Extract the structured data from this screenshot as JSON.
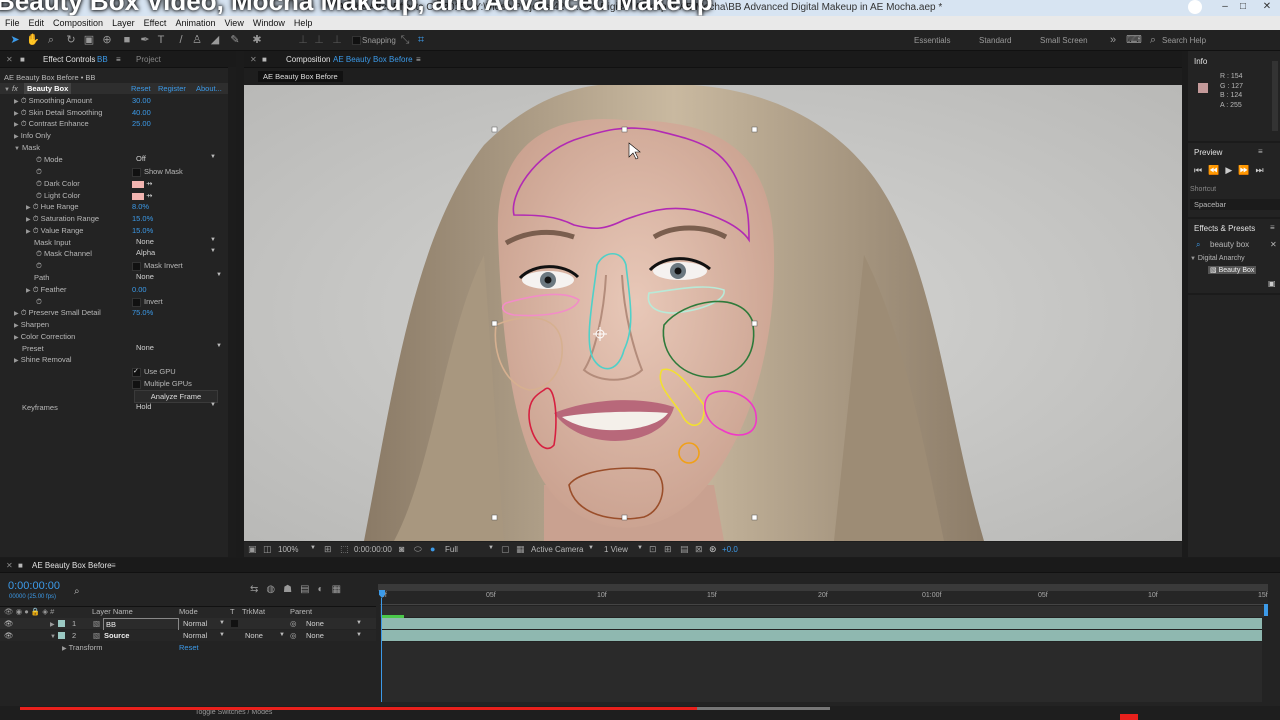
{
  "overlay_title": "Beauty Box Video, Mocha Makeup, and Advanced Makeup",
  "window": {
    "title": "Adobe After Effects CC 2015 - Y:\\Video Projects\\42 - ...ced Digital Makeup in AE Mocha\\BB Advanced Digital Makeup in AE Mocha.aep *"
  },
  "menu": [
    "File",
    "Edit",
    "Composition",
    "Layer",
    "Effect",
    "Animation",
    "View",
    "Window",
    "Help"
  ],
  "toolbar": {
    "snapping": "Snapping",
    "workspaces": [
      "Essentials",
      "Standard",
      "Small Screen"
    ],
    "search_help": "Search Help"
  },
  "effect_controls": {
    "tab": "Effect Controls",
    "tab_layer": "BB",
    "tab_project": "Project",
    "breadcrumb": "AE Beauty Box Before • BB",
    "effect_name": "Beauty Box",
    "reset": "Reset",
    "register": "Register",
    "about": "About...",
    "params": [
      {
        "label": "Smoothing Amount",
        "value": "30.00"
      },
      {
        "label": "Skin Detail Smoothing",
        "value": "40.00"
      },
      {
        "label": "Contrast Enhance",
        "value": "25.00"
      },
      {
        "label": "Info Only",
        "value": ""
      },
      {
        "label": "Mask",
        "value": ""
      },
      {
        "label": "Mode",
        "value": "Off"
      },
      {
        "label": "",
        "value": "Show Mask"
      },
      {
        "label": "Dark Color",
        "value": ""
      },
      {
        "label": "Light Color",
        "value": ""
      },
      {
        "label": "Hue Range",
        "value": "8.0%"
      },
      {
        "label": "Saturation Range",
        "value": "15.0%"
      },
      {
        "label": "Value Range",
        "value": "15.0%"
      },
      {
        "label": "Mask Input",
        "value": "None"
      },
      {
        "label": "Mask Channel",
        "value": "Alpha"
      },
      {
        "label": "",
        "value": "Mask Invert"
      },
      {
        "label": "Path",
        "value": "None"
      },
      {
        "label": "Feather",
        "value": "0.00"
      },
      {
        "label": "",
        "value": "Invert"
      },
      {
        "label": "Preserve Small Detail",
        "value": "75.0%"
      },
      {
        "label": "Sharpen",
        "value": ""
      },
      {
        "label": "Color Correction",
        "value": ""
      },
      {
        "label": "Preset",
        "value": "None"
      },
      {
        "label": "Shine Removal",
        "value": ""
      },
      {
        "label": "",
        "value": "Use GPU"
      },
      {
        "label": "",
        "value": "Multiple GPUs"
      },
      {
        "label": "",
        "value": "Analyze Frame"
      },
      {
        "label": "Keyframes",
        "value": "Hold"
      }
    ]
  },
  "composition": {
    "tab": "Composition",
    "comp_name": "AE Beauty Box Before",
    "subtab": "AE Beauty Box Before",
    "footer": {
      "zoom": "100%",
      "timecode": "0:00:00:00",
      "resolution": "Full",
      "camera": "Active Camera",
      "views": "1 View",
      "exposure": "+0.0"
    }
  },
  "info": {
    "title": "Info",
    "r": "R : 154",
    "g": "G : 127",
    "b": "B : 124",
    "a": "A : 255",
    "swatch": "#c49a9a"
  },
  "preview": {
    "title": "Preview",
    "shortcut_label": "Shortcut",
    "shortcut_value": "Spacebar"
  },
  "effects_presets": {
    "title": "Effects & Presets",
    "search": "beauty box",
    "category": "Digital Anarchy",
    "item": "Beauty Box"
  },
  "timeline": {
    "tab": "AE Beauty Box Before",
    "timecode": "0:00:00:00",
    "fps": "00000 (25.00 fps)",
    "headers": {
      "layer_name": "Layer Name",
      "mode": "Mode",
      "t": "T",
      "trkmat": "TrkMat",
      "parent": "Parent"
    },
    "layers": [
      {
        "num": "1",
        "name": "BB",
        "mode": "Normal",
        "trkmat": "",
        "parent": "None"
      },
      {
        "num": "2",
        "name": "Source",
        "mode": "Normal",
        "trkmat": "None",
        "parent": "None"
      }
    ],
    "transform": {
      "label": "Transform",
      "reset": "Reset"
    },
    "ruler": [
      "0f",
      "05f",
      "10f",
      "15f",
      "20f",
      "01:00f",
      "05f",
      "10f",
      "15f"
    ],
    "toggle": "Toggle Switches / Modes"
  }
}
